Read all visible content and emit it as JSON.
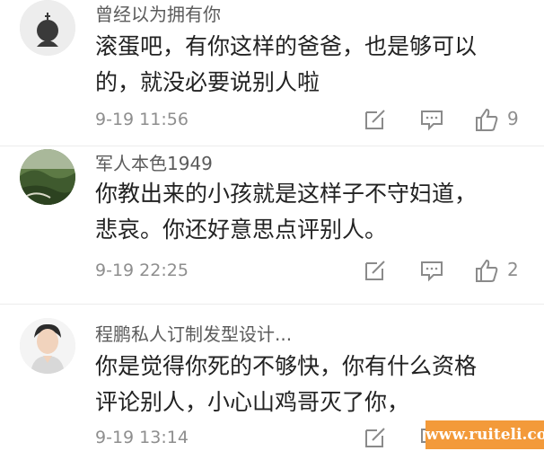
{
  "comments": [
    {
      "username": "曾经以为拥有你",
      "text_lines": [
        "滚蛋吧，有你这样的爸爸，也是够可以",
        "的，就没必要说别人啦"
      ],
      "timestamp": "9-19 11:56",
      "like_count": "9",
      "avatar_icon": "silhouette-avatar-icon"
    },
    {
      "username": "军人本色1949",
      "text_lines": [
        "你教出来的小孩就是这样子不守妇道，",
        "悲哀。你还好意思点评别人。"
      ],
      "timestamp": "9-19 22:25",
      "like_count": "2",
      "avatar_icon": "landscape-avatar-icon"
    },
    {
      "username": "程鹏私人订制发型设计...",
      "text_lines": [
        "你是觉得你死的不够快，你有什么资格",
        "评论别人，小心山鸡哥灭了你，"
      ],
      "timestamp": "9-19 13:14",
      "like_count": "",
      "avatar_icon": "portrait-avatar-icon"
    }
  ],
  "icons": {
    "edit": "edit-icon",
    "reply": "comment-icon",
    "like": "thumbs-up-icon"
  },
  "watermark": "www.ruiteli.com",
  "colors": {
    "username": "#5b5b5b",
    "text": "#222222",
    "meta": "#8e8e8e",
    "watermark_bg": "#f39a3a"
  }
}
